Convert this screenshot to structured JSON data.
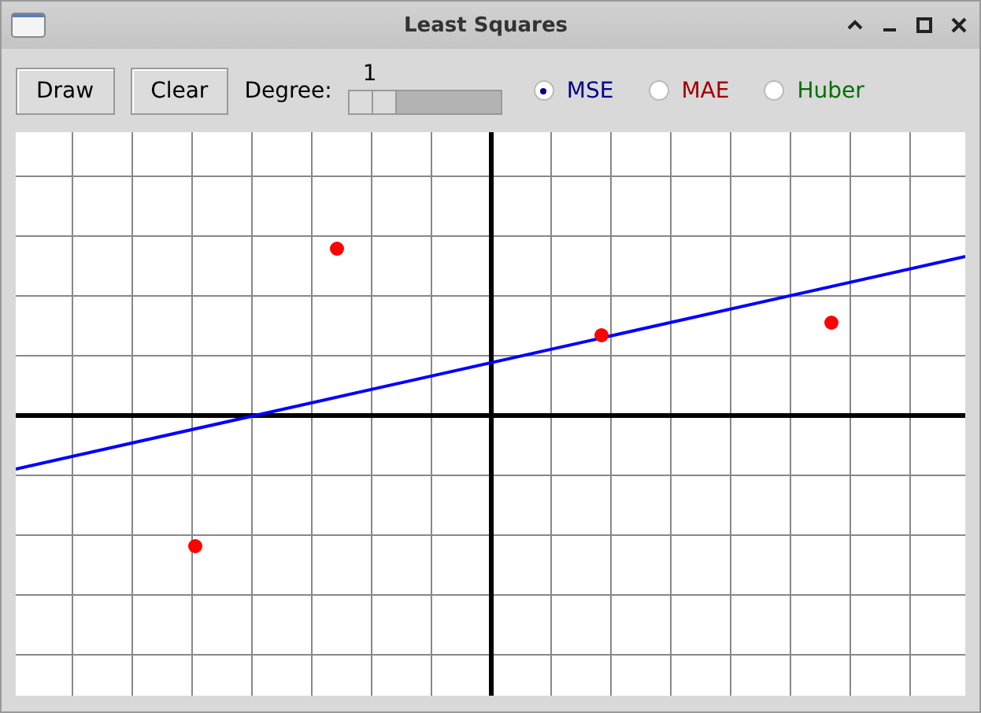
{
  "window": {
    "title": "Least Squares"
  },
  "buttons": [
    "Draw",
    "Clear"
  ],
  "degree": {
    "label": "Degree:",
    "value": "1",
    "level": 0
  },
  "loss_options": [
    {
      "label": "MSE",
      "selected": true,
      "color": "#00008b"
    },
    {
      "label": "MAE",
      "selected": false,
      "color": "#a00000"
    },
    {
      "label": "Huber",
      "selected": false,
      "color": "#007000"
    }
  ]
}
